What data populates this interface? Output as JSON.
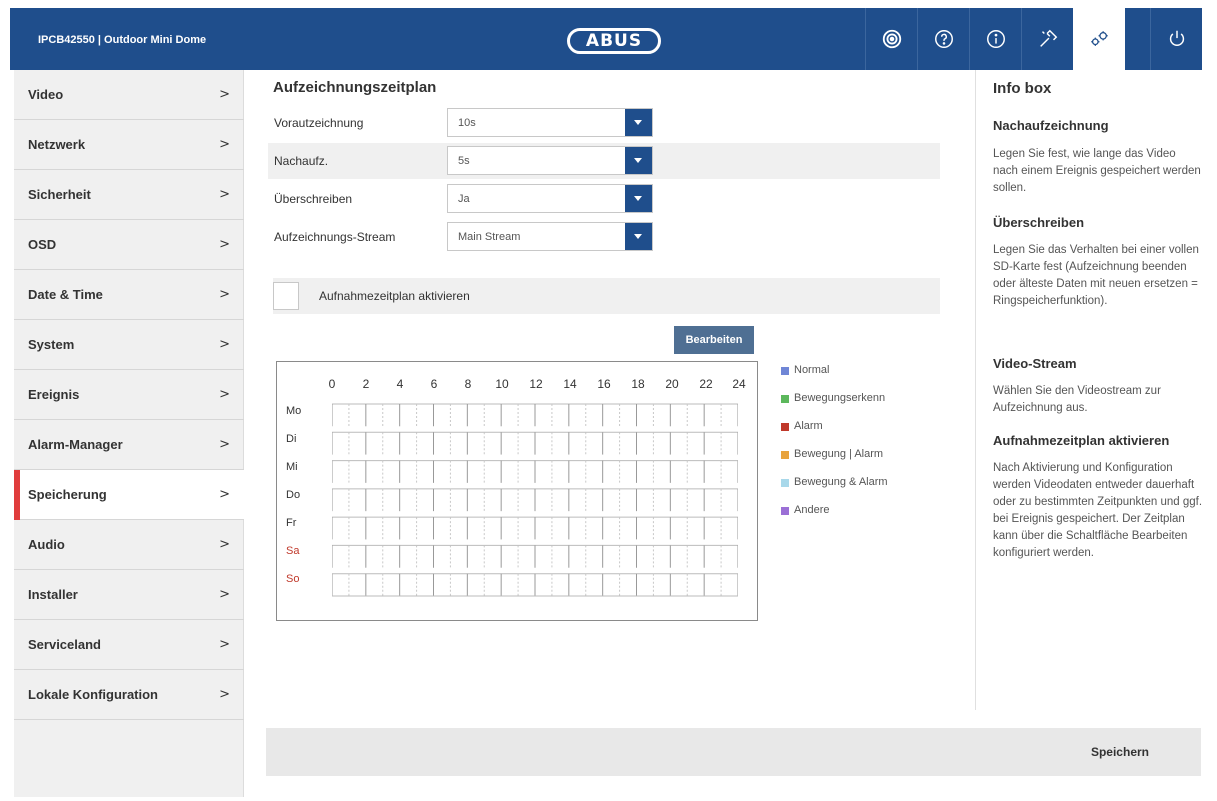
{
  "header": {
    "device_title": "IPCB42550  |  Outdoor Mini Dome",
    "brand": "ABUS",
    "icons": [
      "camera-lens-icon",
      "help-icon",
      "info-icon",
      "tools-icon",
      "settings-gears-icon",
      "power-icon"
    ],
    "active_icon": "settings-gears-icon",
    "accent_color": "#1f4e8c"
  },
  "sidebar": {
    "items": [
      {
        "label": "Video",
        "chevron": ">"
      },
      {
        "label": "Netzwerk",
        "chevron": ">"
      },
      {
        "label": "Sicherheit",
        "chevron": ">"
      },
      {
        "label": "OSD",
        "chevron": ">"
      },
      {
        "label": "Date & Time",
        "chevron": ">"
      },
      {
        "label": "System",
        "chevron": ">"
      },
      {
        "label": "Ereignis",
        "chevron": ">"
      },
      {
        "label": "Alarm-Manager",
        "chevron": ">"
      },
      {
        "label": "Speicherung",
        "chevron": ">"
      },
      {
        "label": "Audio",
        "chevron": ">"
      },
      {
        "label": "Installer",
        "chevron": ">"
      },
      {
        "label": "Serviceland",
        "chevron": ">"
      },
      {
        "label": "Lokale Konfiguration",
        "chevron": ">"
      }
    ],
    "active": "Speicherung",
    "active_color": "#e03c3c"
  },
  "main": {
    "title": "Aufzeichnungszeitplan",
    "fields": [
      {
        "label": "Vorautzeichnung",
        "value": "10s"
      },
      {
        "label": "Nachaufz.",
        "value": "5s"
      },
      {
        "label": "Überschreiben",
        "value": "Ja"
      },
      {
        "label": "Aufzeichnungs-Stream",
        "value": "Main Stream"
      }
    ],
    "activate_label": "Aufnahmezeitplan aktivieren",
    "activate_checked": false,
    "edit_button": "Bearbeiten",
    "schedule": {
      "hours": [
        "0",
        "2",
        "4",
        "6",
        "8",
        "10",
        "12",
        "14",
        "16",
        "18",
        "20",
        "22",
        "24"
      ],
      "days": [
        "Mo",
        "Di",
        "Mi",
        "Do",
        "Fr",
        "Sa",
        "So"
      ],
      "weekend_color": "#c0392b"
    },
    "legend": [
      {
        "label": "Normal",
        "color": "#6f86d6"
      },
      {
        "label": "Bewegungserkenn",
        "color": "#5cb85c"
      },
      {
        "label": "Alarm",
        "color": "#c0392b"
      },
      {
        "label": "Bewegung | Alarm",
        "color": "#e8a33d"
      },
      {
        "label": "Bewegung & Alarm",
        "color": "#a8d8ea"
      },
      {
        "label": "Andere",
        "color": "#9b6fd6"
      }
    ]
  },
  "info": {
    "title": "Info box",
    "sections": [
      {
        "heading": "Nachaufzeichnung",
        "text": "Legen Sie fest, wie lange das Video nach einem Ereignis gespeichert werden sollen."
      },
      {
        "heading": "Überschreiben",
        "text": "Legen Sie das Verhalten bei einer vollen SD-Karte fest (Aufzeichnung beenden oder älteste Daten mit neuen ersetzen = Ringspeicherfunktion)."
      },
      {
        "heading": "Video-Stream",
        "text": "Wählen Sie den Videostream zur Aufzeichnung aus."
      },
      {
        "heading": "Aufnahmezeitplan aktivieren",
        "text": "Nach Aktivierung und Konfiguration werden Videodaten entweder dauerhaft oder zu bestimmten Zeitpunkten und ggf. bei Ereignis gespeichert. Der Zeitplan kann über die Schaltfläche Bearbeiten konfiguriert werden."
      }
    ]
  },
  "footer": {
    "save_label": "Speichern"
  }
}
